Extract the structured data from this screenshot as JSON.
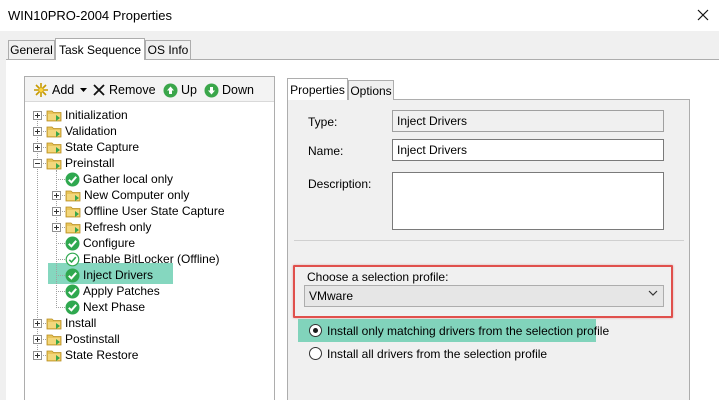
{
  "window": {
    "title": "WIN10PRO-2004 Properties"
  },
  "tabs": [
    {
      "label": "General",
      "selected": false
    },
    {
      "label": "Task Sequence",
      "selected": true
    },
    {
      "label": "OS Info",
      "selected": false
    }
  ],
  "toolbar": {
    "add_label": "Add",
    "remove_label": "Remove",
    "up_label": "Up",
    "down_label": "Down"
  },
  "tree": [
    {
      "label": "Initialization",
      "icon": "folder-icon",
      "expander": "plus"
    },
    {
      "label": "Validation",
      "icon": "folder-icon",
      "expander": "plus"
    },
    {
      "label": "State Capture",
      "icon": "folder-icon",
      "expander": "plus"
    },
    {
      "label": "Preinstall",
      "icon": "folder-icon",
      "expander": "minus"
    },
    {
      "label": "Gather local only",
      "icon": "check-icon",
      "expander": "none"
    },
    {
      "label": "New Computer only",
      "icon": "folder-icon",
      "expander": "plus"
    },
    {
      "label": "Offline User State Capture",
      "icon": "folder-icon",
      "expander": "plus"
    },
    {
      "label": "Refresh only",
      "icon": "folder-icon",
      "expander": "plus"
    },
    {
      "label": "Configure",
      "icon": "check-icon",
      "expander": "none"
    },
    {
      "label": "Enable BitLocker (Offline)",
      "icon": "check-outline-icon",
      "expander": "none"
    },
    {
      "label": "Inject Drivers",
      "icon": "check-icon",
      "expander": "none",
      "selected": true
    },
    {
      "label": "Apply Patches",
      "icon": "check-icon",
      "expander": "none"
    },
    {
      "label": "Next Phase",
      "icon": "check-icon",
      "expander": "none"
    },
    {
      "label": "Install",
      "icon": "folder-icon",
      "expander": "plus"
    },
    {
      "label": "Postinstall",
      "icon": "folder-icon",
      "expander": "plus"
    },
    {
      "label": "State Restore",
      "icon": "folder-icon",
      "expander": "plus"
    }
  ],
  "right_tabs": [
    {
      "label": "Properties",
      "selected": true
    },
    {
      "label": "Options",
      "selected": false
    }
  ],
  "properties": {
    "type_label": "Type:",
    "type_value": "Inject Drivers",
    "name_label": "Name:",
    "name_value": "Inject Drivers",
    "description_label": "Description:",
    "description_value": "",
    "profile_label": "Choose a selection profile:",
    "profile_value": "VMware",
    "radio_matching": "Install only matching drivers from the selection profile",
    "radio_all": "Install all drivers from the selection profile",
    "radio_selected": "matching"
  },
  "colors": {
    "highlight": "#5cc9a9",
    "callout_border": "#e0504c",
    "check_green": "#2fa84f",
    "folder_yellow": "#e8c45a"
  }
}
